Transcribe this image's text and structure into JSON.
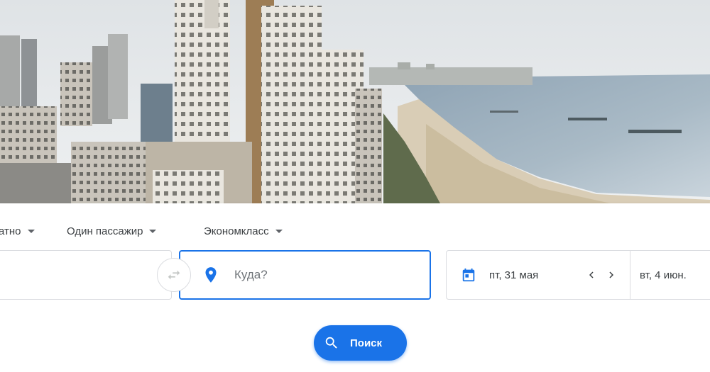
{
  "hero": {
    "image": "city-beach-skyline"
  },
  "options": {
    "trip_type_label": "атно",
    "passengers_label": "Один пассажир",
    "cabin_class_label": "Экономкласс"
  },
  "search_form": {
    "origin_value": "",
    "destination_placeholder": "Куда?",
    "departure_date": "пт, 31 мая",
    "return_date": "вт, 4 июн."
  },
  "search_button": {
    "label": "Поиск"
  },
  "colors": {
    "accent": "#1a73e8",
    "border": "#dadce0",
    "text": "#3c4043"
  },
  "icons": [
    "chevron-down-icon",
    "swap-icon",
    "location-pin-icon",
    "calendar-icon",
    "chevron-left-icon",
    "chevron-right-icon",
    "search-icon"
  ]
}
